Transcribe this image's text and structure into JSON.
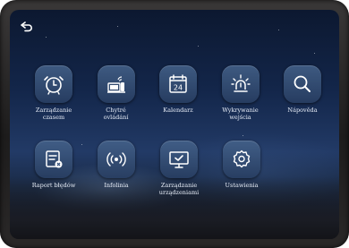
{
  "back": {
    "icon": "back-arrow-icon"
  },
  "tiles_row1": [
    {
      "label": "Zarządzanie\nczasem",
      "icon": "alarm-clock-icon"
    },
    {
      "label": "Chytré\novládání",
      "icon": "remote-control-icon"
    },
    {
      "label": "Kalendarz",
      "icon": "calendar-icon"
    },
    {
      "label": "Wykrywanie\nwejścia",
      "icon": "alarm-light-icon"
    },
    {
      "label": "Nápověda",
      "icon": "search-icon"
    }
  ],
  "tiles_row2": [
    {
      "label": "Raport błędów",
      "icon": "report-icon"
    },
    {
      "label": "Infolinia",
      "icon": "signal-icon"
    },
    {
      "label": "Zarządzanie\nurządzeniami",
      "icon": "device-check-icon"
    },
    {
      "label": "Ustawienia",
      "icon": "settings-gear-icon"
    }
  ],
  "colors": {
    "icon_bg": "#3a5580",
    "label": "#e8eef8"
  }
}
